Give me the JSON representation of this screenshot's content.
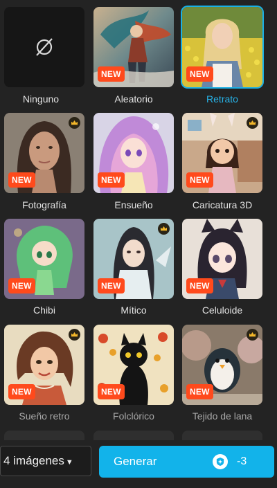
{
  "styles": [
    {
      "label": "Ninguno",
      "new": false,
      "premium": false,
      "selected": false
    },
    {
      "label": "Aleatorio",
      "new": true,
      "premium": false,
      "selected": false
    },
    {
      "label": "Retrato",
      "new": true,
      "premium": false,
      "selected": true
    },
    {
      "label": "Fotografía",
      "new": true,
      "premium": true,
      "selected": false
    },
    {
      "label": "Ensueño",
      "new": true,
      "premium": false,
      "selected": false
    },
    {
      "label": "Caricatura 3D",
      "new": true,
      "premium": true,
      "selected": false
    },
    {
      "label": "Chibi",
      "new": true,
      "premium": false,
      "selected": false
    },
    {
      "label": "Mítico",
      "new": true,
      "premium": true,
      "selected": false
    },
    {
      "label": "Celuloide",
      "new": true,
      "premium": false,
      "selected": false
    },
    {
      "label": "Sueño retro",
      "new": true,
      "premium": true,
      "selected": false
    },
    {
      "label": "Folclórico",
      "new": true,
      "premium": false,
      "selected": false
    },
    {
      "label": "Tejido de lana",
      "new": true,
      "premium": true,
      "selected": false
    }
  ],
  "badge_text": "NEW",
  "none_icon": "empty-set-icon",
  "premium_icon": "crown-icon",
  "footer": {
    "image_count": "4 imágenes",
    "generate_label": "Generar",
    "credit_cost": "-3",
    "credit_icon": "credit-gem-icon"
  },
  "colors": {
    "accent": "#12b3ea",
    "selected_label": "#27b3e8",
    "new_badge": "#ff4a1c",
    "background": "#232323"
  }
}
